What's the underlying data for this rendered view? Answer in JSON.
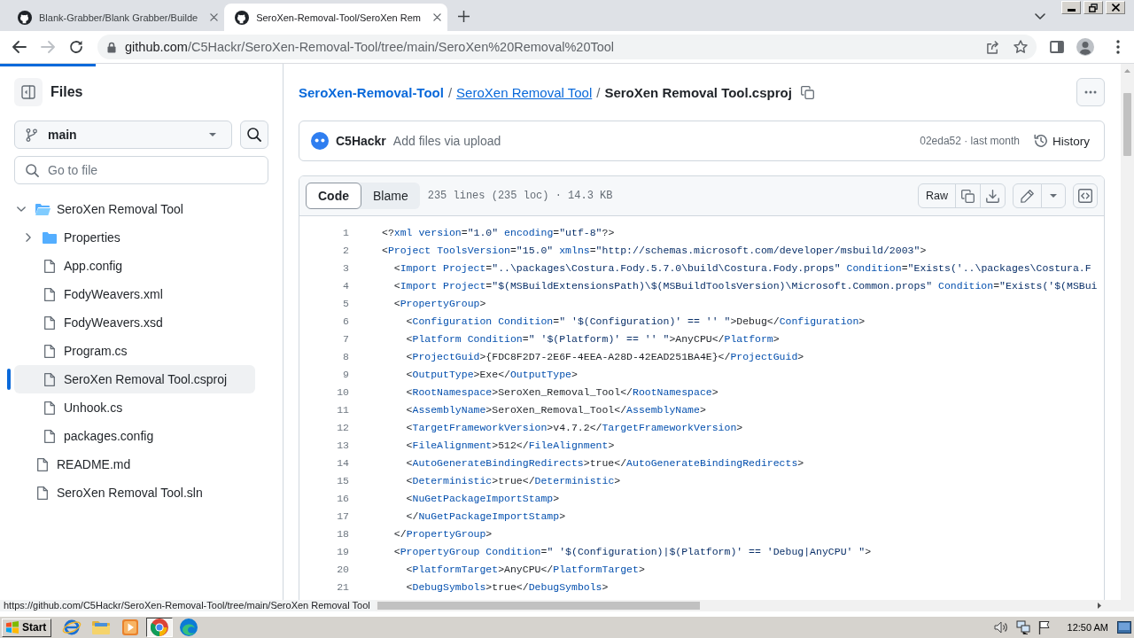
{
  "browser": {
    "tabs": [
      {
        "title": "Blank-Grabber/Blank Grabber/Builde",
        "selected": false
      },
      {
        "title": "SeroXen-Removal-Tool/SeroXen Rem",
        "selected": true
      }
    ],
    "nav": [
      {
        "kind": "back",
        "disabled": false
      },
      {
        "kind": "forward",
        "disabled": true
      },
      {
        "kind": "reload",
        "disabled": false
      }
    ],
    "address": "github.com/C5Hackr/SeroXen-Removal-Tool/tree/main/SeroXen%20Removal%20Tool",
    "load_progress": {
      "level": 0.084
    },
    "status_url": "https://github.com/C5Hackr/SeroXen-Removal-Tool/tree/main/SeroXen Removal Tool"
  },
  "sidebar": {
    "title": "Files",
    "branch": "main",
    "search": {
      "placeholder": "Go to file"
    },
    "tree": [
      {
        "name": "SeroXen Removal Tool",
        "kind": "folder",
        "expanded": true,
        "selected": false,
        "children": [
          {
            "name": "Properties",
            "kind": "folder",
            "expanded": false,
            "selected": false
          },
          {
            "name": "App.config",
            "kind": "file",
            "selected": false
          },
          {
            "name": "FodyWeavers.xml",
            "kind": "file",
            "selected": false
          },
          {
            "name": "FodyWeavers.xsd",
            "kind": "file",
            "selected": false
          },
          {
            "name": "Program.cs",
            "kind": "file",
            "selected": false
          },
          {
            "name": "SeroXen Removal Tool.csproj",
            "kind": "file",
            "selected": true
          },
          {
            "name": "Unhook.cs",
            "kind": "file",
            "selected": false
          },
          {
            "name": "packages.config",
            "kind": "file",
            "selected": false
          }
        ]
      },
      {
        "name": "README.md",
        "kind": "file",
        "selected": false
      },
      {
        "name": "SeroXen Removal Tool.sln",
        "kind": "file",
        "selected": false
      }
    ]
  },
  "breadcrumb": [
    {
      "label": "SeroXen-Removal-Tool",
      "kind": "repo"
    },
    {
      "label": "/",
      "kind": "separator"
    },
    {
      "label": "SeroXen Removal Tool",
      "kind": "folder"
    },
    {
      "label": "/",
      "kind": "separator"
    },
    {
      "label": "SeroXen Removal Tool.csproj",
      "kind": "current"
    }
  ],
  "commit": {
    "author": "C5Hackr",
    "message": "Add files via upload",
    "info": "02eda52 · last month",
    "history": "History"
  },
  "file": {
    "views": [
      {
        "label": "Code",
        "selected": true
      },
      {
        "label": "Blame",
        "selected": false
      }
    ],
    "info": "235 lines (235 loc) · 14.3 KB",
    "raw": "Raw",
    "lines": [
      {
        "number": "1",
        "text": "<?xml version=\"1.0\" encoding=\"utf-8\"?>"
      },
      {
        "number": "2",
        "text": "<Project ToolsVersion=\"15.0\" xmlns=\"http://schemas.microsoft.com/developer/msbuild/2003\">"
      },
      {
        "number": "3",
        "text": "  <Import Project=\"..\\packages\\Costura.Fody.5.7.0\\build\\Costura.Fody.props\" Condition=\"Exists('..\\packages\\Costura.F"
      },
      {
        "number": "4",
        "text": "  <Import Project=\"$(MSBuildExtensionsPath)\\$(MSBuildToolsVersion)\\Microsoft.Common.props\" Condition=\"Exists('$(MSBui"
      },
      {
        "number": "5",
        "text": "  <PropertyGroup>"
      },
      {
        "number": "6",
        "text": "    <Configuration Condition=\" '$(Configuration)' == '' \">Debug</Configuration>"
      },
      {
        "number": "7",
        "text": "    <Platform Condition=\" '$(Platform)' == '' \">AnyCPU</Platform>"
      },
      {
        "number": "8",
        "text": "    <ProjectGuid>{FDC8F2D7-2E6F-4EEA-A28D-42EAD251BA4E}</ProjectGuid>"
      },
      {
        "number": "9",
        "text": "    <OutputType>Exe</OutputType>"
      },
      {
        "number": "10",
        "text": "    <RootNamespace>SeroXen_Removal_Tool</RootNamespace>"
      },
      {
        "number": "11",
        "text": "    <AssemblyName>SeroXen_Removal_Tool</AssemblyName>"
      },
      {
        "number": "12",
        "text": "    <TargetFrameworkVersion>v4.7.2</TargetFrameworkVersion>"
      },
      {
        "number": "13",
        "text": "    <FileAlignment>512</FileAlignment>"
      },
      {
        "number": "14",
        "text": "    <AutoGenerateBindingRedirects>true</AutoGenerateBindingRedirects>"
      },
      {
        "number": "15",
        "text": "    <Deterministic>true</Deterministic>"
      },
      {
        "number": "16",
        "text": "    <NuGetPackageImportStamp>"
      },
      {
        "number": "17",
        "text": "    </NuGetPackageImportStamp>"
      },
      {
        "number": "18",
        "text": "  </PropertyGroup>"
      },
      {
        "number": "19",
        "text": "  <PropertyGroup Condition=\" '$(Configuration)|$(Platform)' == 'Debug|AnyCPU' \">"
      },
      {
        "number": "20",
        "text": "    <PlatformTarget>AnyCPU</PlatformTarget>"
      },
      {
        "number": "21",
        "text": "    <DebugSymbols>true</DebugSymbols>"
      }
    ]
  },
  "taskbar": {
    "start": "Start",
    "apps": [
      {
        "kind": "globe",
        "selected": false
      },
      {
        "kind": "folder",
        "selected": false
      },
      {
        "kind": "player",
        "selected": false
      },
      {
        "kind": "ring",
        "selected": true
      },
      {
        "kind": "wave",
        "selected": false
      }
    ],
    "clock": "12:50 AM"
  }
}
